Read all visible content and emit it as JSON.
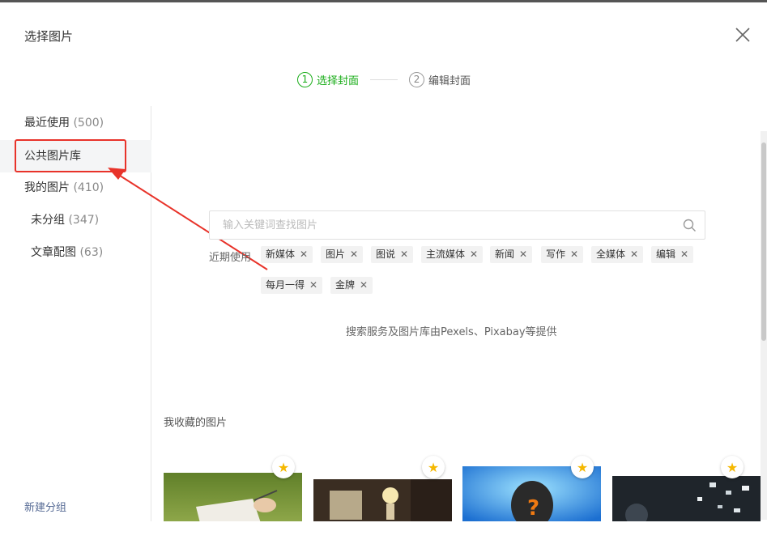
{
  "dialog": {
    "title": "选择图片"
  },
  "steps": [
    {
      "num": "1",
      "label": "选择封面"
    },
    {
      "num": "2",
      "label": "编辑封面"
    }
  ],
  "sidebar": {
    "items": [
      {
        "label": "最近使用",
        "count": "(500)"
      },
      {
        "label": "公共图片库",
        "count": ""
      },
      {
        "label": "我的图片",
        "count": "(410)"
      },
      {
        "label": "未分组",
        "count": "(347)"
      },
      {
        "label": "文章配图",
        "count": "(63)"
      }
    ],
    "new_group": "新建分组"
  },
  "search": {
    "placeholder": "输入关键词查找图片"
  },
  "recent": {
    "label": "近期使用",
    "tags": [
      "新媒体",
      "图片",
      "图说",
      "主流媒体",
      "新闻",
      "写作",
      "全媒体",
      "编辑",
      "每月一得",
      "金牌"
    ]
  },
  "provider_note": "搜索服务及图片库由Pexels、Pixabay等提供",
  "favorites": {
    "title": "我收藏的图片"
  },
  "colors": {
    "accent": "#1aad19",
    "highlight": "#e8332a",
    "star": "#f5b800"
  },
  "icons": {
    "close": "close-icon",
    "search": "search-icon",
    "star": "star-icon"
  }
}
